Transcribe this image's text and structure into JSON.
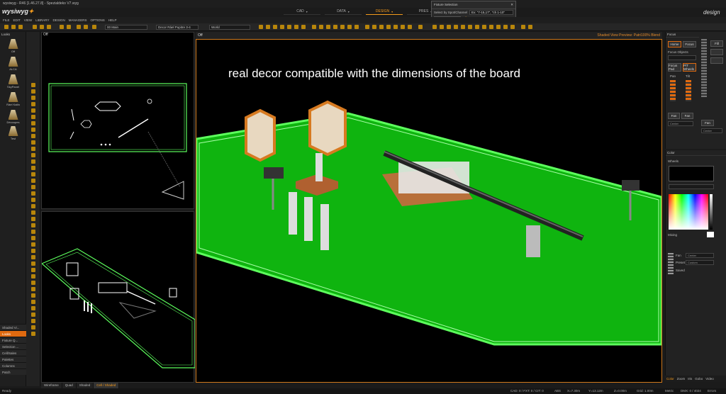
{
  "titlebar": {
    "title": "wysiwyg - R46 [1.46.27.8] - Spezialdeko V7.wyg",
    "brand_logo": "wysiwyg",
    "brand_right": "design"
  },
  "mode_tabs": [
    {
      "label": "CAD"
    },
    {
      "label": "DATA"
    },
    {
      "label": "DESIGN"
    },
    {
      "label": "PRES"
    }
  ],
  "menu": [
    "FILE",
    "EDIT",
    "VIEW",
    "LIBRARY",
    "DESIGN",
    "MANAGERS",
    "OPTIONS",
    "HELP"
  ],
  "fixture_popup": {
    "title": "Fixture Selection",
    "select_label": "Select by Spot/Channel",
    "select_value": "Ex: \"7-15,17\", \"ch 1-10\"",
    "select_features": "Select Features"
  },
  "toolbar": {
    "layer": "00 Main",
    "decor": "Decor Ráel Pupitre 3-4",
    "world": "World"
  },
  "looks": {
    "header": "Looks",
    "items": [
      "Off",
      "ALCA",
      "SkyPanel",
      "Ráel Kaifa",
      "Découpes",
      "Test"
    ]
  },
  "palette_tabs": [
    "Shaded Vi...",
    "Looks",
    "Fixture Q...",
    "Selection ...",
    "Cell/Sales",
    "Palettes",
    "Columns",
    "Patch"
  ],
  "viewports": {
    "top_label": "Off",
    "main_header": "Shaded View Preview: Patri100% Blend",
    "overlay_text": "real decor compatible with the dimensions of the board"
  },
  "viewport_tabs": [
    "Wireframe",
    "Quad",
    "Shaded",
    "Cell / Shaded"
  ],
  "focus_panel": {
    "title": "Focus",
    "home": "Home",
    "focus": "Focus",
    "focus_objects": "Focus Objects",
    "focus_pad": "Focus Pad",
    "pt_wheels": "P/T Wheels",
    "pan": "Pan",
    "tilt": "Tilt",
    "fan": "Fan",
    "fan2": "Fan",
    "center": "Center"
  },
  "fade_panel": {
    "fill": "Fill",
    "fan": "Fan",
    "center": "Center"
  },
  "color_panel": {
    "title": "Color",
    "wheels": "Wheels",
    "mixing": "Mixing",
    "fan": "Fan",
    "preset": "Preset",
    "center": "Center",
    "custom": "Custom",
    "saved": "Saved"
  },
  "right_tabs": [
    "Color",
    "Zoom",
    "Iris",
    "Gobo",
    "Video"
  ],
  "status": {
    "left": "Ready",
    "cad": "CAD: 0 / FXT: 0 / CIT: 0",
    "abs": "ABS",
    "x": "X=7.30m",
    "y": "Y=13.12m",
    "z": "Z=0.00m",
    "grid": "Grid: 1.00m",
    "metric": "Metric",
    "dmx": "DMX: 0 / 4024",
    "errors": "Errors"
  },
  "colors": {
    "accent": "#e06a10",
    "stage_green": "#0fb40f",
    "stage_edge": "#5dff5d",
    "wireframe": "#ffffff"
  }
}
